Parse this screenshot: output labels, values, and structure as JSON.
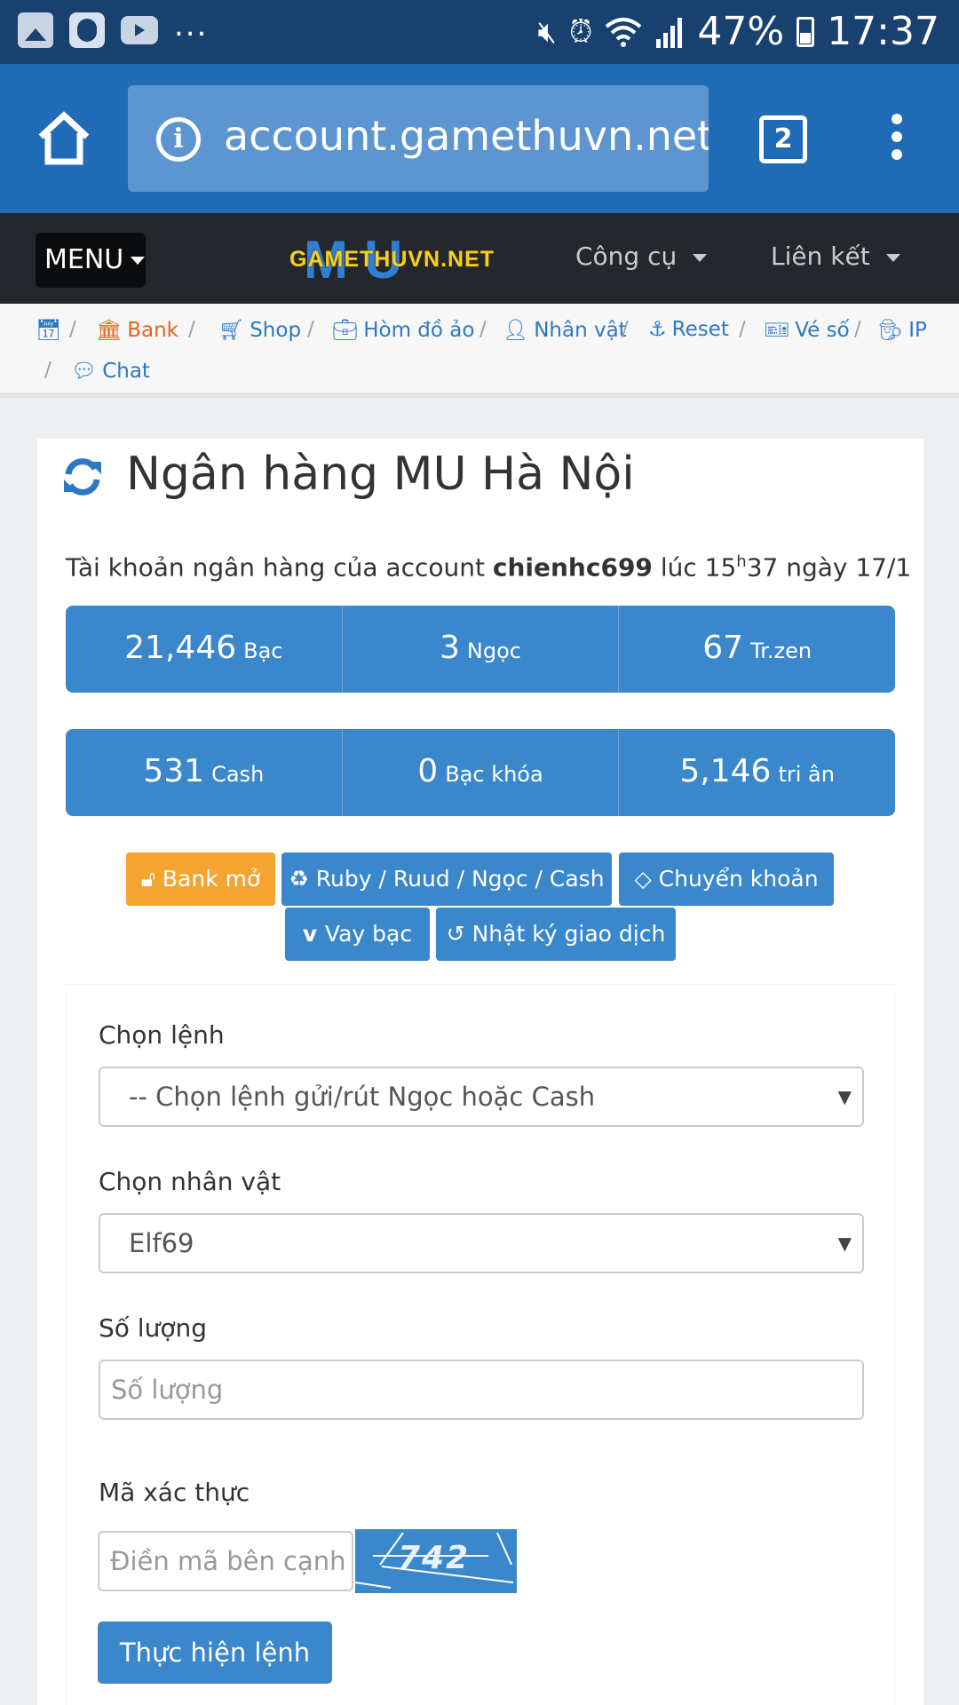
{
  "status_bar": {
    "notification_icons": [
      "gallery-icon",
      "app-face-icon",
      "youtube-icon"
    ],
    "overflow": "...",
    "battery": "47%",
    "time": "17:37"
  },
  "browser": {
    "url": "account.gamethuvn.net/",
    "tab_count": "2"
  },
  "site_nav": {
    "menu_label": "MENU",
    "logo_text": "GAMETHUVN.NET",
    "logo_bg_text": "MU",
    "tools_label": "Công cụ",
    "links_label": "Liên kết"
  },
  "breadcrumbs": [
    {
      "label": "",
      "icon": "calendar-icon"
    },
    {
      "label": "Bank",
      "icon": "bank-icon",
      "active": true
    },
    {
      "label": "Shop",
      "icon": "cart-icon"
    },
    {
      "label": "Hòm đồ ảo",
      "icon": "briefcase-icon"
    },
    {
      "label": "Nhân vật",
      "icon": "user-icon"
    },
    {
      "label": "Reset",
      "icon": "reset-icon"
    },
    {
      "label": "Vé số",
      "icon": "ticket-icon"
    },
    {
      "label": "IP",
      "icon": "user-secret-icon"
    },
    {
      "label": "Chat",
      "icon": "chat-icon"
    }
  ],
  "card": {
    "title": "Ngân hàng MU Hà Nội",
    "account_prefix": "Tài khoản ngân hàng của account",
    "account_name": "chienhc699",
    "time_prefix": "lúc 15",
    "time_sup": "h",
    "time_suffix": "37 ngày 17/1"
  },
  "balances_row1": [
    {
      "value": "21,446",
      "unit": "Bạc"
    },
    {
      "value": "3",
      "unit": "Ngọc"
    },
    {
      "value": "67",
      "unit": "Tr.zen"
    }
  ],
  "balances_row2": [
    {
      "value": "531",
      "unit": "Cash"
    },
    {
      "value": "0",
      "unit": "Bạc khóa"
    },
    {
      "value": "5,146",
      "unit": "tri ân"
    }
  ],
  "actions": {
    "bank_open": "Bank mở",
    "exchange": "Ruby / Ruud / Ngọc / Cash",
    "transfer": "Chuyển khoản",
    "loan": "Vay bạc",
    "history": "Nhật ký giao dịch"
  },
  "form": {
    "command_label": "Chọn lệnh",
    "command_value": "-- Chọn lệnh gửi/rút Ngọc hoặc Cash",
    "character_label": "Chọn nhân vật",
    "character_value": "Elf69",
    "amount_label": "Số lượng",
    "amount_placeholder": "Số lượng",
    "captcha_label": "Mã xác thực",
    "captcha_placeholder": "Điền mã bên cạnh",
    "captcha_code": "742",
    "submit_label": "Thực hiện lệnh"
  },
  "colors": {
    "status_bar": "#18416f",
    "toolbar": "#1f6bb5",
    "nav": "#24272b",
    "accent_blue": "#3a87cc",
    "active_orange": "#e5621f",
    "button_orange": "#f4a431"
  }
}
